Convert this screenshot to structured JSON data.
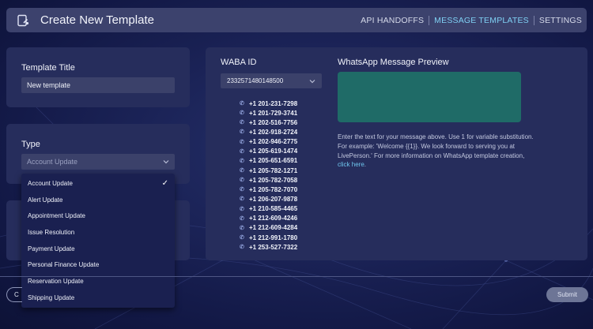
{
  "header": {
    "title": "Create New Template",
    "nav": [
      {
        "label": "API HANDOFFS",
        "active": false
      },
      {
        "label": "MESSAGE TEMPLATES",
        "active": true
      },
      {
        "label": "SETTINGS",
        "active": false
      }
    ]
  },
  "template_title": {
    "label": "Template Title",
    "value": "New template"
  },
  "type": {
    "label": "Type",
    "placeholder": "Account Update",
    "selected": "Account Update",
    "options": [
      "Account Update",
      "Alert Update",
      "Appointment Update",
      "Issue Resolution",
      "Payment Update",
      "Personal Finance Update",
      "Reservation Update",
      "Shipping Update"
    ]
  },
  "waba": {
    "label": "WABA ID",
    "selected": "2332571480148500",
    "phones": [
      "+1 201-231-7298",
      "+1 201-729-3741",
      "+1 202-516-7756",
      "+1 202-918-2724",
      "+1 202-946-2775",
      "+1 205-619-1474",
      "+1 205-651-6591",
      "+1 205-782-1271",
      "+1 205-782-7058",
      "+1 205-782-7070",
      "+1 206-207-9878",
      "+1 210-585-4465",
      "+1 212-609-4246",
      "+1 212-609-4284",
      "+1 212-991-1780",
      "+1 253-527-7322"
    ]
  },
  "preview": {
    "label": "WhatsApp Message Preview",
    "help_text": "Enter the text for your message above. Use 1 for variable substitution. For example: 'Welcome {{1}}. We look forward to serving you at LivePerson.' For more information on WhatsApp template creation,",
    "help_link": "click here",
    "help_end": "."
  },
  "footer": {
    "cancel_partial": "C",
    "submit_label": "Submit"
  },
  "colors": {
    "accent": "#7fd0f3",
    "preview_bg": "#1f6b67",
    "card_bg": "#262d5c"
  }
}
